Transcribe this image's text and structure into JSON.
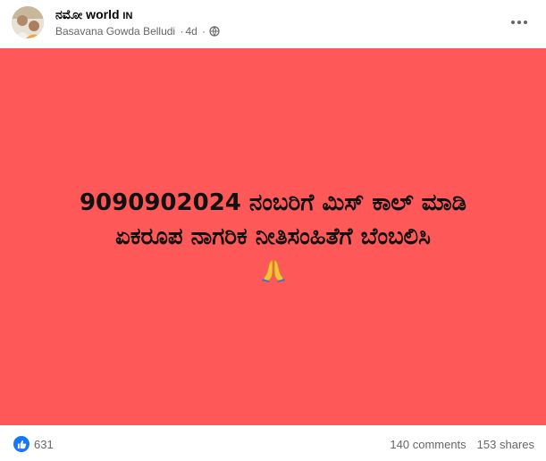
{
  "post": {
    "group_name": "ನಮೋ world",
    "group_badge": "IN",
    "author": "Basavana Gowda Belludi",
    "time": "4d",
    "separator": "·",
    "privacy_icon": "globe-icon",
    "more_icon": "more-options-icon"
  },
  "banner": {
    "line1": "9090902024 ನಂಬರಿಗೆ ಮಿಸ್ ಕಾಲ್ ಮಾಡಿ",
    "line2": "ಏಕರೂಪ ನಾಗರಿಕ ನೀತಿಸಂಹಿತೆಗೆ ಬೆಂಬಲಿಸಿ",
    "emoji": "praying-hands",
    "background": "#fe5858"
  },
  "footer": {
    "reaction_icon": "like-icon",
    "reaction_count": "631",
    "comments": "140 comments",
    "shares": "153 shares"
  },
  "colors": {
    "accent": "#1877f2",
    "muted_text": "#65676b"
  }
}
